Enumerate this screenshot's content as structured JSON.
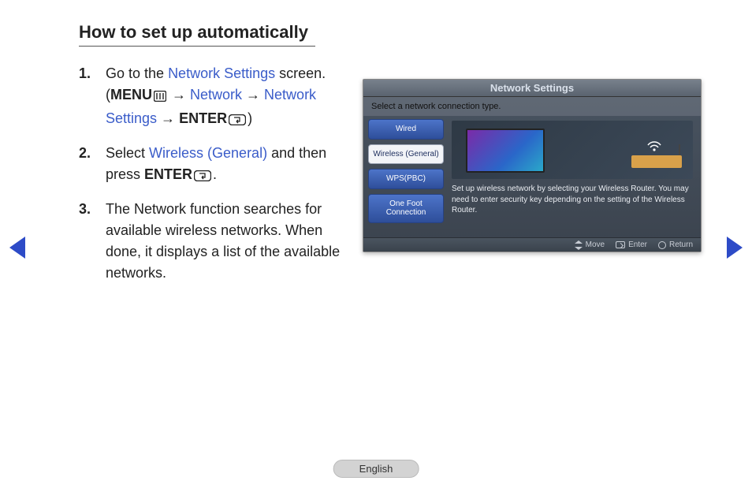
{
  "title": "How to set up automatically",
  "steps": {
    "s1": {
      "num": "1.",
      "t1": "Go to the ",
      "link1": "Network Settings",
      "t2": " screen. (",
      "bold1": "MENU",
      "arrow": " → ",
      "link2": "Network",
      "link3": "Network Settings",
      "bold2": "ENTER",
      "close": ")"
    },
    "s2": {
      "num": "2.",
      "t1": "Select ",
      "link1": "Wireless (General)",
      "t2": "  and then press ",
      "bold1": "ENTER",
      "t3": "."
    },
    "s3": {
      "num": "3.",
      "t1": "The Network function searches for available wireless networks. When done, it displays a list of the available networks."
    }
  },
  "panel": {
    "header": "Network Settings",
    "subhead": "Select a network connection type.",
    "options": {
      "wired": "Wired",
      "wireless": "Wireless (General)",
      "wps": "WPS(PBC)",
      "onefoot": "One Foot Connection"
    },
    "desc": "Set up wireless network by selecting your Wireless Router. You may need to enter security key depending on the setting of the Wireless Router.",
    "footer": {
      "move": "Move",
      "enter": "Enter",
      "return": "Return"
    }
  },
  "language": "English"
}
